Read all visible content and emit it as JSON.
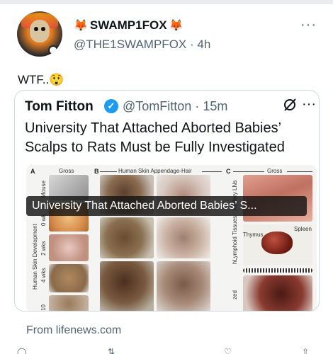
{
  "author": {
    "display_name": "SWAMP1FOX",
    "name_prefix_emoji": "🦊",
    "name_suffix_emoji": "🦊",
    "handle": "@THE1SWAMPFOX",
    "time": "4h"
  },
  "tweet": {
    "text": "WTF..😲"
  },
  "quoted": {
    "display_name": "Tom Fitton",
    "handle": "@TomFitton",
    "time": "15m",
    "headline": "University That Attached Aborted Babies’ Scalps to Rats Must be Fully Investigated",
    "media_caption": "University That Attached Aborted Babies’ S..."
  },
  "figure": {
    "panel_a": "A",
    "panel_b": "B",
    "panel_c": "C",
    "a_header": "Gross",
    "b_header": "Human Skin Appendage-Hair",
    "c_header": "Gross",
    "row_mouse": "Mouse",
    "row_0wk": "0 wk",
    "row_2wks": "2 wks",
    "row_4wks": "4 wks",
    "row_10": "10",
    "side_label": "Human Skin Development",
    "c_row1": "Axillary LNs",
    "c_row2": "hLymphoid Tissues",
    "c_row3": "zed",
    "thymus": "Thymus",
    "spleen": "Spleen"
  },
  "source": "From lifenews.com",
  "icons": {
    "more": "more-icon",
    "verified": "verified-badge-icon",
    "grok": "grok-icon",
    "reply": "reply-icon",
    "retweet": "retweet-icon",
    "like": "like-icon",
    "share": "share-icon"
  }
}
